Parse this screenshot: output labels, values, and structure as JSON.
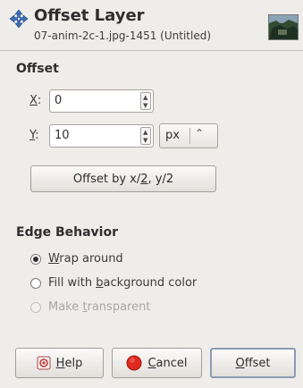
{
  "dialog": {
    "title": "Offset Layer",
    "subtitle": "07-anim-2c-1.jpg-1451 (Untitled)"
  },
  "offset": {
    "section_label": "Offset",
    "x_label_mnemonic": "X",
    "x_label_rest": ":",
    "x_value": "0",
    "y_label_mnemonic": "Y",
    "y_label_rest": ":",
    "y_value": "10",
    "unit": "px",
    "offset_half_pre": "Offset by x/",
    "offset_half_mn": "2",
    "offset_half_post": ", y/2"
  },
  "edge": {
    "section_label": "Edge Behavior",
    "options": [
      {
        "pre": "",
        "mn": "W",
        "post": "rap around",
        "checked": true,
        "disabled": false
      },
      {
        "pre": "Fill with ",
        "mn": "b",
        "post": "ackground color",
        "checked": false,
        "disabled": false
      },
      {
        "pre": "Make ",
        "mn": "t",
        "post": "ransparent",
        "checked": false,
        "disabled": true
      }
    ]
  },
  "buttons": {
    "help_mn": "H",
    "help_rest": "elp",
    "cancel_mn": "C",
    "cancel_rest": "ancel",
    "ok_mn": "O",
    "ok_rest": "ffset"
  },
  "icons": {
    "title_icon": "move-cross-icon",
    "help_icon": "help-icon",
    "cancel_icon": "cancel-icon",
    "spin_up": "arrow-up-icon",
    "spin_down": "arrow-down-icon",
    "combo_arrow": "chevron-updown-icon"
  },
  "colors": {
    "background": "#efedea",
    "title_icon": "#3b6fb6",
    "cancel_red": "#e02a1f"
  }
}
